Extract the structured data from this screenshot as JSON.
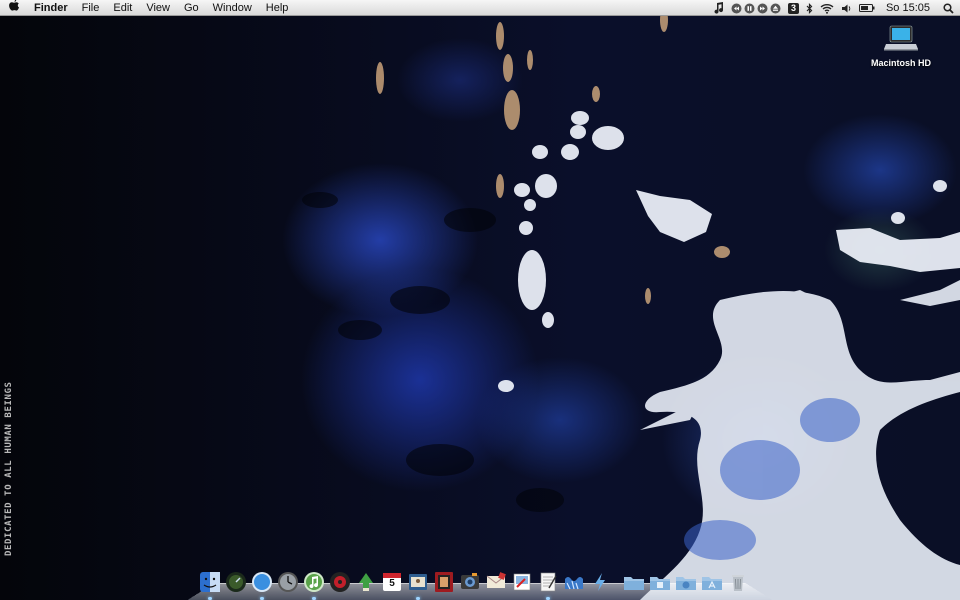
{
  "menubar": {
    "app_name": "Finder",
    "items": [
      "File",
      "Edit",
      "View",
      "Go",
      "Window",
      "Help"
    ],
    "battery_badge": "3",
    "clock": "So 15:05"
  },
  "desktop": {
    "icons": [
      {
        "label": "Macintosh HD",
        "icon": "laptop-icon"
      }
    ],
    "wallpaper_text": "DEDICATED TO ALL HUMAN BEINGS"
  },
  "dock": {
    "calendar_day": "5",
    "items": [
      "finder-icon",
      "dashboard-icon",
      "safari-icon",
      "clock-icon",
      "itunes-icon",
      "dvd-player-icon",
      "rocket-icon",
      "ical-icon",
      "address-book-icon",
      "photo-booth-icon",
      "iphoto-icon",
      "mail-icon",
      "preview-icon",
      "textedit-icon",
      "wave-icon",
      "lightning-icon",
      "applications-folder-icon",
      "documents-folder-icon",
      "downloads-folder-icon",
      "app-store-folder-icon",
      "trash-icon"
    ]
  },
  "colors": {
    "menubar_bg": "#e6e6e6",
    "wallpaper_blue": "#2a47c0",
    "splash_white": "#e8ecf5"
  }
}
